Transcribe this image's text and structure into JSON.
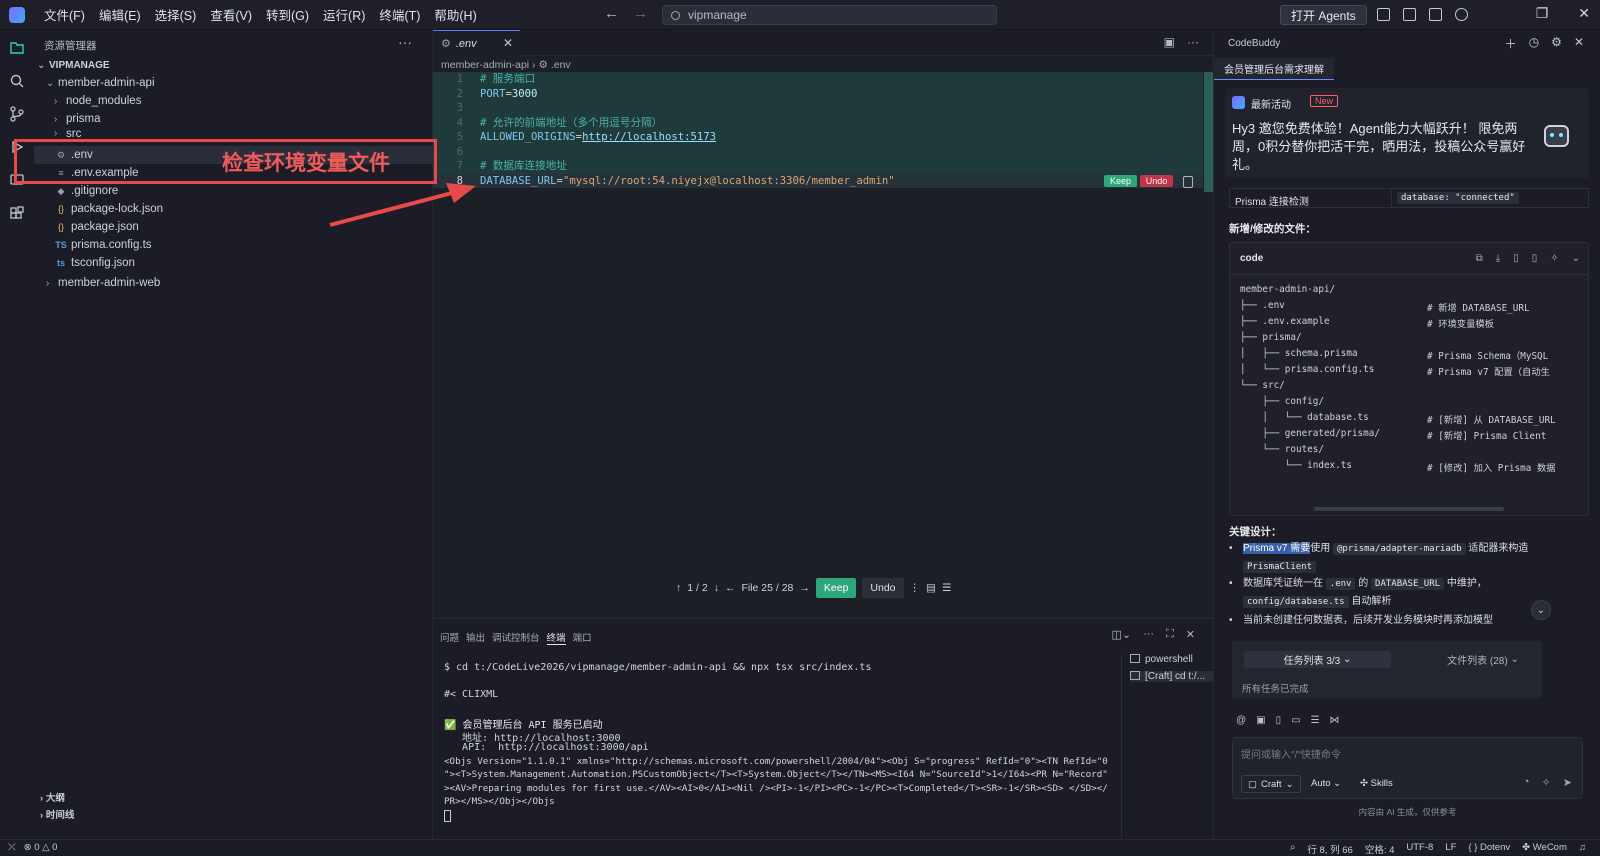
{
  "menu": [
    "文件(F)",
    "编辑(E)",
    "选择(S)",
    "查看(V)",
    "转到(G)",
    "运行(R)",
    "终端(T)",
    "帮助(H)"
  ],
  "search": {
    "value": "vipmanage"
  },
  "open_agents": "打开 Agents",
  "explorer": {
    "title": "资源管理器",
    "root": "VIPMANAGE",
    "items": [
      {
        "label": "member-admin-api",
        "indent": 1,
        "type": "folder-open"
      },
      {
        "label": "node_modules",
        "indent": 2,
        "type": "folder"
      },
      {
        "label": "prisma",
        "indent": 2,
        "type": "folder"
      },
      {
        "label": "src",
        "indent": 2,
        "type": "folder"
      },
      {
        "label": ".env",
        "indent": 2,
        "type": "gear"
      },
      {
        "label": ".env.example",
        "indent": 2,
        "type": "lines"
      },
      {
        "label": ".gitignore",
        "indent": 2,
        "type": "dot"
      },
      {
        "label": "package-lock.json",
        "indent": 2,
        "type": "json"
      },
      {
        "label": "package.json",
        "indent": 2,
        "type": "json"
      },
      {
        "label": "prisma.config.ts",
        "indent": 2,
        "type": "ts"
      },
      {
        "label": "tsconfig.json",
        "indent": 2,
        "type": "tsjson"
      },
      {
        "label": "member-admin-web",
        "indent": 1,
        "type": "folder"
      }
    ],
    "outline": "大纲",
    "timeline": "时间线"
  },
  "annotation": {
    "text": "检查环境变量文件",
    "color": "#e64a4a"
  },
  "editor": {
    "tab": ".env",
    "breadcrumb": [
      "member-admin-api",
      ".env"
    ],
    "lines": [
      {
        "n": "1",
        "comment": "# 服务端口"
      },
      {
        "n": "2",
        "key": "PORT",
        "value": "3000"
      },
      {
        "n": "3"
      },
      {
        "n": "4",
        "comment": "# 允许的前端地址（多个用逗号分隔）"
      },
      {
        "n": "5",
        "key": "ALLOWED_ORIGINS",
        "url": "http://localhost:5173"
      },
      {
        "n": "6"
      },
      {
        "n": "7",
        "comment": "# 数据库连接地址"
      },
      {
        "n": "8",
        "key": "DATABASE_URL",
        "string": "\"mysql://root:54.niyejx@localhost:3306/member_admin\""
      }
    ],
    "inline_keep": "Keep",
    "inline_undo": "Undo",
    "diff_toolbar": {
      "position": "1 / 2",
      "file": "File 25 / 28",
      "keep": "Keep",
      "undo": "Undo"
    }
  },
  "panel": {
    "tabs": [
      "问题",
      "输出",
      "调试控制台",
      "终端",
      "端口"
    ],
    "active_tab": "终端",
    "lines": [
      "$ cd t:/CodeLive2026/vipmanage/member-admin-api && npx tsx src/index.ts",
      "",
      "#< CLIXML",
      "",
      "✅ 会员管理后台 API 服务已启动",
      "   地址: http://localhost:3000",
      "   API:  http://localhost:3000/api",
      "<Objs Version=\"1.1.0.1\" xmlns=\"http://schemas.microsoft.com/powershell/2004/04\"><Obj S=\"progress\" RefId=\"0\"><TN RefId=\"0",
      "\"><T>System.Management.Automation.PSCustomObject</T><T>System.Object</T></TN><MS><I64 N=\"SourceId\">1</I64><PR N=\"Record\"",
      "><AV>Preparing modules for first use.</AV><AI>0</AI><Nil /><PI>-1</PI><PC>-1</PC><T>Completed</T><SR>-1</SR><SD> </SD></",
      "PR></MS></Obj></Objs"
    ],
    "terminals": [
      "powershell",
      "[Craft] cd t:/..."
    ]
  },
  "ai": {
    "title": "CodeBuddy",
    "session_tab": "会员管理后台需求理解",
    "news_label": "最新活动",
    "news_badge": "New",
    "news_body": "Hy3 邀您免费体验！Agent能力大幅跃升！ 限免两周，0积分替你把活干完，晒用法，投稿公众号赢好礼。",
    "prisma_check": "Prisma 连接检测",
    "prisma_status": "database: \"connected\"",
    "files_heading": "新增/修改的文件：",
    "code_label": "code",
    "tree": [
      {
        "t": "member-admin-api/",
        "c": ""
      },
      {
        "t": "├── .env",
        "c": "# 新增 DATABASE_URL"
      },
      {
        "t": "├── .env.example",
        "c": "# 环境变量模板"
      },
      {
        "t": "├── prisma/",
        "c": ""
      },
      {
        "t": "│   ├── schema.prisma",
        "c": "# Prisma Schema（MySQL"
      },
      {
        "t": "│   └── prisma.config.ts",
        "c": "# Prisma v7 配置（自动生"
      },
      {
        "t": "└── src/",
        "c": ""
      },
      {
        "t": "    ├── config/",
        "c": ""
      },
      {
        "t": "    │   └── database.ts",
        "c": "# [新增] 从 DATABASE_URL"
      },
      {
        "t": "    ├── generated/prisma/",
        "c": "# [新增] Prisma Client"
      },
      {
        "t": "    └── routes/",
        "c": ""
      },
      {
        "t": "        └── index.ts",
        "c": "# [修改] 加入 Prisma 数据"
      }
    ],
    "design_heading": "关键设计：",
    "bullets": [
      {
        "hl": "Prisma v7 需要",
        "a": "使用",
        "code1": "@prisma/adapter-mariadb",
        "b": "适配器来构造",
        "code2": "PrismaClient"
      },
      {
        "a": "数据库凭证统一在",
        "code1": ".env",
        "b": "的",
        "code2": "DATABASE_URL",
        "c": "中维护，",
        "code3": "config/database.ts",
        "d": "自动解析"
      },
      {
        "a": "当前未创建任何数据表，后续开发业务模块时再添加模型"
      }
    ],
    "task_tab": "任务列表 3/3",
    "file_tab": "文件列表 (28)",
    "tasks_done": "所有任务已完成",
    "input_placeholder": "提问或输入\"/\"快捷命令",
    "craft": "Craft",
    "auto": "Auto",
    "skills": "Skills",
    "disclaimer": "内容由 AI 生成，仅供参考"
  },
  "status": {
    "errors": "0",
    "warnings": "0",
    "position": "行 8, 列 66",
    "spaces": "空格: 4",
    "encoding": "UTF-8",
    "eol": "LF",
    "language": "Dotenv",
    "wecom": "WeCom"
  }
}
